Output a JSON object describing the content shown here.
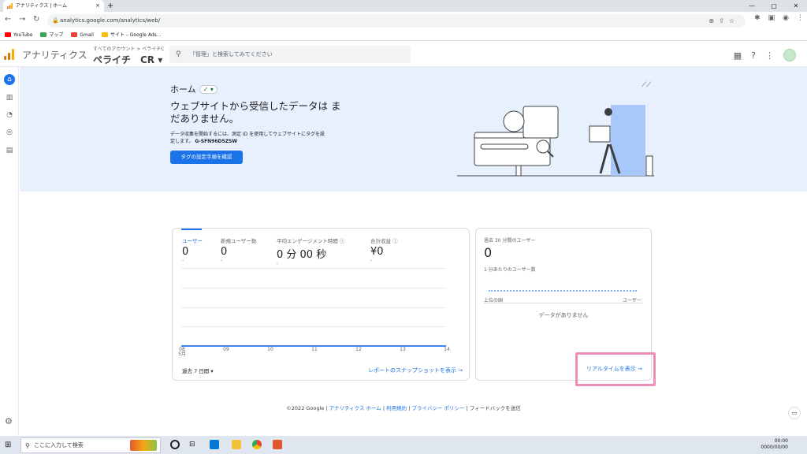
{
  "browser": {
    "tab_title": "アナリティクス | ホーム",
    "tab_close": "×",
    "new_tab": "+",
    "url": "analytics.google.com/analytics/web/",
    "bookmarks": [
      {
        "label": "YouTube",
        "color": "#ff0000"
      },
      {
        "label": "マップ",
        "color": "#34a853"
      },
      {
        "label": "Gmail",
        "color": "#ea4335"
      },
      {
        "label": "サイト – Google Ads...",
        "color": "#fbbc04"
      }
    ]
  },
  "header": {
    "app_name": "アナリティクス",
    "breadcrumb": "すべてのアカウント > ペライチC",
    "property": "ペライチ　CR ▾",
    "search_placeholder": "「管理」と検索してみてください"
  },
  "hero": {
    "page_title": "ホーム",
    "title": "ウェブサイトから受信したデータは まだありません。",
    "description": "データ収集を開始するには、測定 ID を使用してウェブサイトにタグを設定します。",
    "measurement_id": "G-SFN96D5ZSW",
    "button": "タグの設定手順を確認"
  },
  "metrics": [
    {
      "label": "ユーザー",
      "value": "0",
      "sub": "-"
    },
    {
      "label": "新規ユーザー数",
      "value": "0",
      "sub": "-"
    },
    {
      "label": "平均エンゲージメント時間 ⓘ",
      "value": "0 分 00 秒",
      "sub": "-"
    },
    {
      "label": "合計収益 ⓘ",
      "value": "¥0",
      "sub": "-"
    }
  ],
  "chart_data": {
    "type": "line",
    "x": [
      "08 5月",
      "09",
      "10",
      "11",
      "12",
      "13",
      "14"
    ],
    "series": [
      {
        "values": [
          0,
          0,
          0,
          0,
          0,
          0,
          0
        ]
      }
    ],
    "color": "#4285f4"
  },
  "overview": {
    "period": "過去 7 日間 ▾",
    "snapshot_link": "レポートのスナップショットを表示 →"
  },
  "realtime": {
    "label": "過去 30 分間のユーザー",
    "value": "0",
    "per_minute": "1 分あたりのユーザー数",
    "col_left": "上位の国",
    "col_right": "ユーザー",
    "no_data": "データがありません",
    "link": "リアルタイムを表示 →",
    "highlight_color": "#ec8fb8"
  },
  "footer": {
    "copyright": "©2022 Google |",
    "home": "アナリティクス ホーム",
    "sep1": "|",
    "terms": "利用規約",
    "sep2": "|",
    "privacy": "プライバシー ポリシー",
    "sep3": "|",
    "feedback": "フィードバックを送信"
  },
  "taskbar": {
    "search_placeholder": "ここに入力して検索",
    "time": "00:00",
    "date": "0000/00/00"
  },
  "colors": {
    "accent": "#1a73e8",
    "hero_bg": "#e8f0fe"
  }
}
